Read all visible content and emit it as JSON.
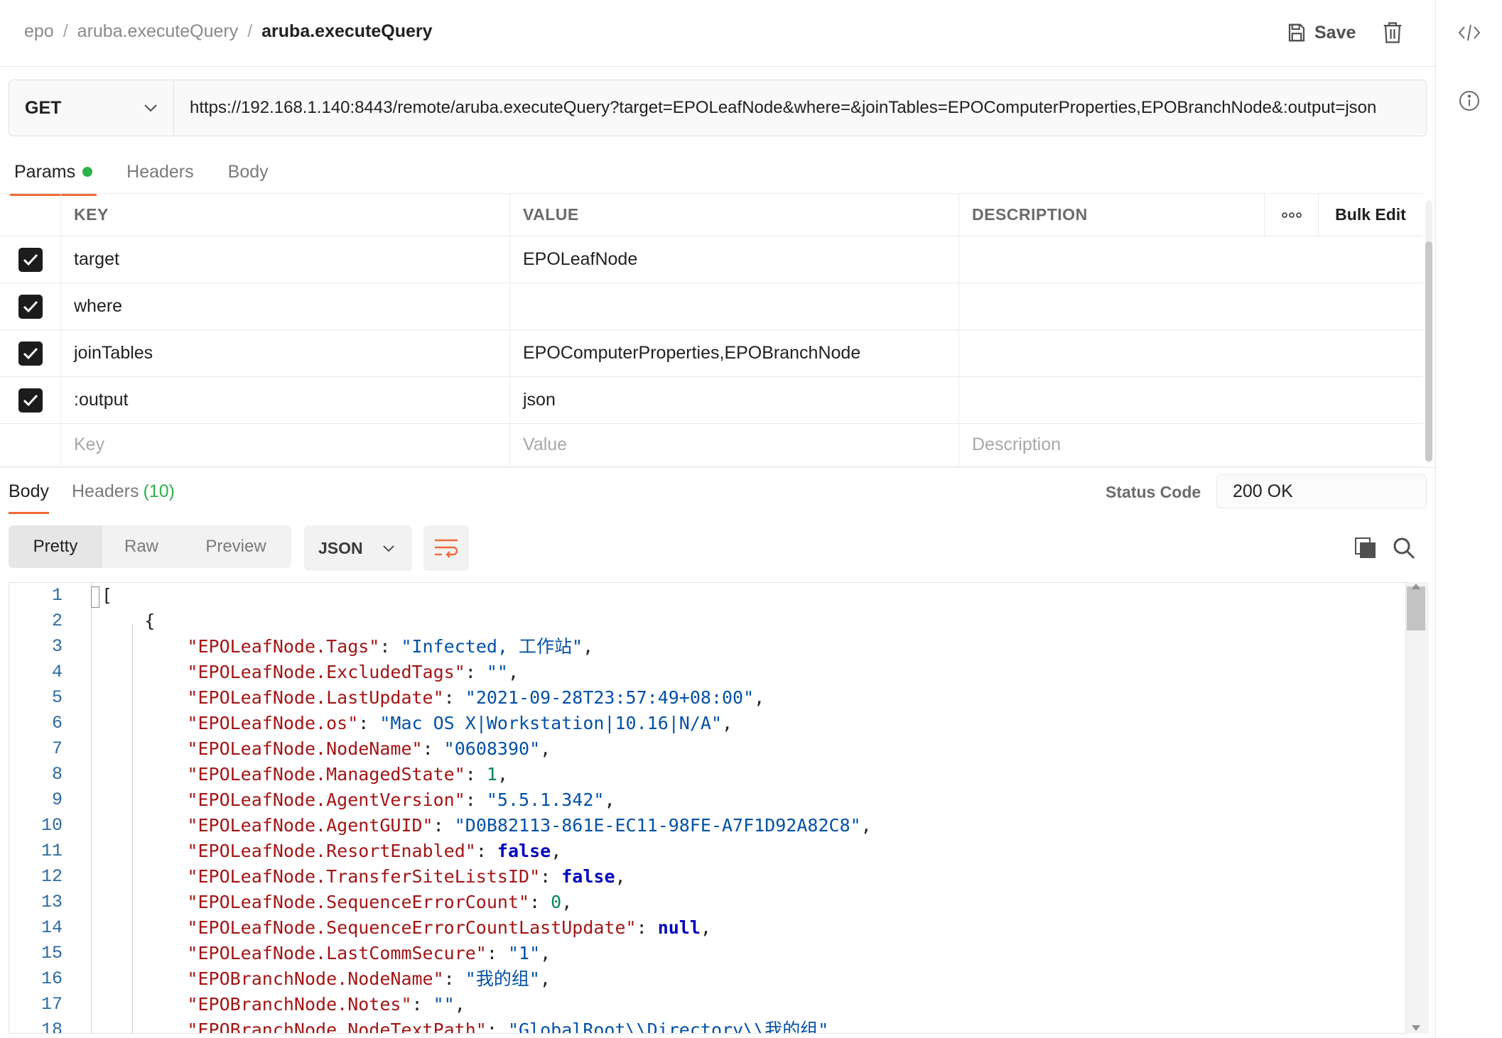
{
  "breadcrumb": [
    "epo",
    "aruba.executeQuery",
    "aruba.executeQuery"
  ],
  "breadcrumb_sep": "/",
  "header": {
    "save_label": "Save"
  },
  "request": {
    "method": "GET",
    "url": "https://192.168.1.140:8443/remote/aruba.executeQuery?target=EPOLeafNode&where=&joinTables=EPOComputerProperties,EPOBranchNode&:output=json"
  },
  "request_tabs": [
    "Params",
    "Headers",
    "Body"
  ],
  "params": {
    "columns": {
      "key": "KEY",
      "value": "VALUE",
      "description": "DESCRIPTION",
      "bulk_edit": "Bulk Edit"
    },
    "rows": [
      {
        "key": "target",
        "value": "EPOLeafNode",
        "checked": true
      },
      {
        "key": "where",
        "value": "",
        "checked": true
      },
      {
        "key": "joinTables",
        "value": "EPOComputerProperties,EPOBranchNode",
        "checked": true
      },
      {
        "key": ":output",
        "value": "json",
        "checked": true
      }
    ],
    "placeholders": {
      "key": "Key",
      "value": "Value",
      "description": "Description"
    }
  },
  "response": {
    "tabs": [
      "Body",
      "Headers"
    ],
    "headers_count": "(10)",
    "status_label": "Status Code",
    "status_value": "200 OK",
    "views": [
      "Pretty",
      "Raw",
      "Preview"
    ],
    "format": "JSON"
  },
  "code_lines": [
    "[",
    "    {",
    "        \"EPOLeafNode.Tags\": \"Infected, 工作站\",",
    "        \"EPOLeafNode.ExcludedTags\": \"\",",
    "        \"EPOLeafNode.LastUpdate\": \"2021-09-28T23:57:49+08:00\",",
    "        \"EPOLeafNode.os\": \"Mac OS X|Workstation|10.16|N/A\",",
    "        \"EPOLeafNode.NodeName\": \"0608390\",",
    "        \"EPOLeafNode.ManagedState\": 1,",
    "        \"EPOLeafNode.AgentVersion\": \"5.5.1.342\",",
    "        \"EPOLeafNode.AgentGUID\": \"D0B82113-861E-EC11-98FE-A7F1D92A82C8\",",
    "        \"EPOLeafNode.ResortEnabled\": false,",
    "        \"EPOLeafNode.TransferSiteListsID\": false,",
    "        \"EPOLeafNode.SequenceErrorCount\": 0,",
    "        \"EPOLeafNode.SequenceErrorCountLastUpdate\": null,",
    "        \"EPOLeafNode.LastCommSecure\": \"1\",",
    "        \"EPOBranchNode.NodeName\": \"我的组\",",
    "        \"EPOBranchNode.Notes\": \"\",",
    "        \"EPOBranchNode.NodeTextPath\": \"GlobalRoot\\\\Directory\\\\我的组\","
  ]
}
